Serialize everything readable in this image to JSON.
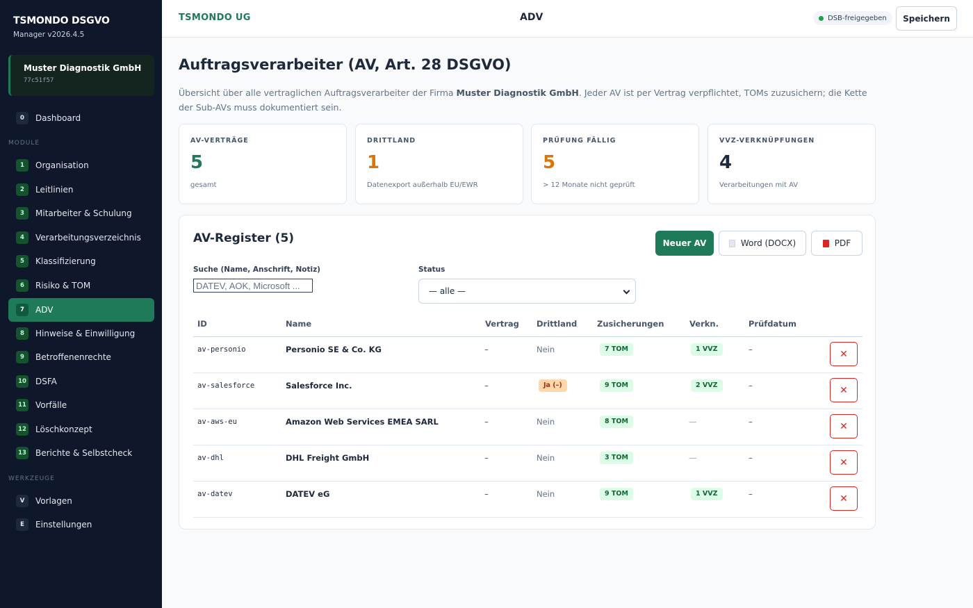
{
  "sidebar": {
    "brand_name": "TSMONDO DSGVO",
    "version": "Manager v2026.4.5",
    "org": {
      "name": "Muster Diagnostik GmbH",
      "id": "77c51f57"
    },
    "dashboard": {
      "num": "0",
      "label": "Dashboard"
    },
    "section_modules": "MODULE",
    "modules": [
      {
        "num": "1",
        "label": "Organisation"
      },
      {
        "num": "2",
        "label": "Leitlinien"
      },
      {
        "num": "3",
        "label": "Mitarbeiter & Schulung"
      },
      {
        "num": "4",
        "label": "Verarbeitungsverzeichnis"
      },
      {
        "num": "5",
        "label": "Klassifizierung"
      },
      {
        "num": "6",
        "label": "Risiko & TOM"
      },
      {
        "num": "7",
        "label": "ADV",
        "active": true
      },
      {
        "num": "8",
        "label": "Hinweise & Einwilligung"
      },
      {
        "num": "9",
        "label": "Betroffenenrechte"
      },
      {
        "num": "10",
        "label": "DSFA"
      },
      {
        "num": "11",
        "label": "Vorfälle"
      },
      {
        "num": "12",
        "label": "Löschkonzept"
      },
      {
        "num": "13",
        "label": "Berichte & Selbstcheck"
      }
    ],
    "section_tools": "WERKZEUGE",
    "tools": [
      {
        "num": "V",
        "label": "Vorlagen"
      },
      {
        "num": "E",
        "label": "Einstellungen"
      }
    ]
  },
  "topbar": {
    "brand": "TSMONDO UG",
    "title": "ADV",
    "status_badge": "DSB-freigegeben",
    "save_label": "Speichern"
  },
  "main": {
    "title": "Auftragsverarbeiter (AV, Art. 28 DSGVO)",
    "intro_pre": "Übersicht über alle vertraglichen Auftragsverarbeiter der Firma ",
    "intro_company": "Muster Diagnostik GmbH",
    "intro_post": ". Jeder AV ist per Vertrag verpflichtet, TOMs zuzusichern; die Kette der Sub-AVs muss dokumentiert sein.",
    "stats": [
      {
        "label": "AV-VERTRÄGE",
        "value": "5",
        "sub": "gesamt",
        "color": "#1e7a58"
      },
      {
        "label": "DRITTLAND",
        "value": "1",
        "sub": "Datenexport außerhalb EU/EWR",
        "color": "#d97706"
      },
      {
        "label": "PRÜFUNG FÄLLIG",
        "value": "5",
        "sub": "> 12 Monate nicht geprüft",
        "color": "#d97706"
      },
      {
        "label": "VVZ-VERKNÜPFUNGEN",
        "value": "4",
        "sub": "Verarbeitungen mit AV",
        "color": "#1e293b"
      }
    ]
  },
  "register": {
    "title": "AV-Register (5)",
    "new_label": "Neuer AV",
    "word_label": "Word (DOCX)",
    "pdf_label": "PDF",
    "search_label": "Suche (Name, Anschrift, Notiz)",
    "search_placeholder": "DATEV, AOK, Microsoft ...",
    "status_label": "Status",
    "status_value": "— alle —",
    "columns": {
      "id": "ID",
      "name": "Name",
      "vertrag": "Vertrag",
      "drittland": "Drittland",
      "zusicherungen": "Zusicherungen",
      "verkn": "Verkn.",
      "pruefdatum": "Prüfdatum"
    },
    "rows": [
      {
        "id": "av-personio",
        "name": "Personio SE & Co. KG",
        "vertrag": "–",
        "drittland": "Nein",
        "tom": "7 TOM",
        "vvz": "1 VVZ",
        "pruef": "–",
        "delete": "✕"
      },
      {
        "id": "av-salesforce",
        "name": "Salesforce Inc.",
        "vertrag": "–",
        "drittland_pill": "Ja (–)",
        "tom": "9 TOM",
        "vvz": "2 VVZ",
        "pruef": "–",
        "delete": "✕"
      },
      {
        "id": "av-aws-eu",
        "name": "Amazon Web Services EMEA SARL",
        "vertrag": "–",
        "drittland": "Nein",
        "tom": "8 TOM",
        "vvz_none": "—",
        "pruef": "–",
        "delete": "✕"
      },
      {
        "id": "av-dhl",
        "name": "DHL Freight GmbH",
        "vertrag": "–",
        "drittland": "Nein",
        "tom": "3 TOM",
        "vvz_none": "—",
        "pruef": "–",
        "delete": "✕"
      },
      {
        "id": "av-datev",
        "name": "DATEV eG",
        "vertrag": "–",
        "drittland": "Nein",
        "tom": "9 TOM",
        "vvz": "1 VVZ",
        "pruef": "–",
        "delete": "✕"
      }
    ]
  }
}
